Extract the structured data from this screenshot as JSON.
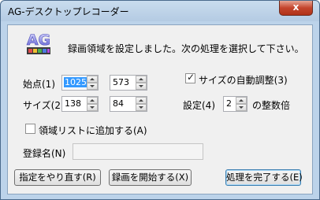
{
  "window": {
    "title": "AG-デスクトップレコーダー",
    "close_glyph": "x"
  },
  "message": "録画領域を設定しました。次の処理を選択して下さい。",
  "icon": {
    "name": "ag-app-icon",
    "text": "AG"
  },
  "start_point": {
    "label": "始点(1)",
    "x": "1025",
    "y": "573"
  },
  "size": {
    "label": "サイズ(2)",
    "width": "138",
    "height": "84"
  },
  "auto_adjust": {
    "label": "サイズの自動調整(3)",
    "checked": true
  },
  "setting": {
    "label": "設定(4)",
    "value": "2",
    "suffix": "の整数倍"
  },
  "add_to_list": {
    "label": "領域リストに追加する(A)",
    "checked": false
  },
  "register_name": {
    "label": "登録名(N)",
    "value": ""
  },
  "buttons": {
    "redo": "指定をやり直す(R)",
    "start": "録画を開始する(X)",
    "finish": "処理を完了する(E)"
  },
  "colors": {
    "title_bar": "#bcd3ea",
    "close_button": "#c4452d",
    "selection": "#3399ff",
    "client_bg": "#f0f0f0"
  }
}
